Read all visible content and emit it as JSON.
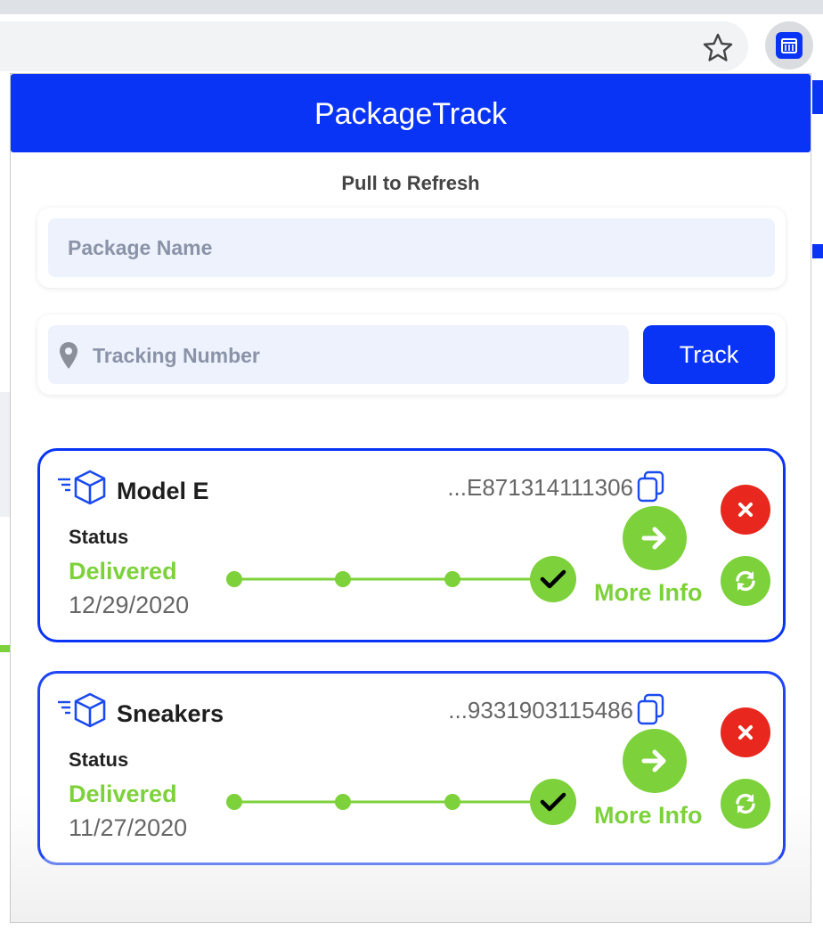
{
  "browser": {
    "star_icon": "star-outline-icon",
    "extension_icon": "package-track-extension-icon"
  },
  "popup": {
    "title": "PackageTrack",
    "pull_to_refresh": "Pull to Refresh",
    "package_name_placeholder": "Package Name",
    "package_name_value": "",
    "tracking_number_placeholder": "Tracking Number",
    "tracking_number_value": "",
    "track_button": "Track"
  },
  "colors": {
    "brand_blue": "#0a34f5",
    "delivered_green": "#7dd13b",
    "delete_red": "#e8281e"
  },
  "packages": [
    {
      "name": "Model E",
      "tracking": "...E871314111306",
      "status_label": "Status",
      "status": "Delivered",
      "date": "12/29/2020",
      "progress_steps_total": 4,
      "progress_steps_completed": 4,
      "more_info": "More Info"
    },
    {
      "name": "Sneakers",
      "tracking": "...9331903115486",
      "status_label": "Status",
      "status": "Delivered",
      "date": "11/27/2020",
      "progress_steps_total": 4,
      "progress_steps_completed": 4,
      "more_info": "More Info"
    }
  ]
}
